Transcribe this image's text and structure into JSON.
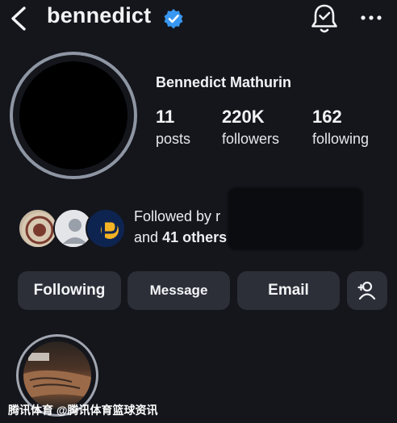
{
  "header": {
    "username": "bennedict",
    "icons": [
      "back-arrow-icon",
      "verified-badge-icon",
      "notification-bell-icon",
      "more-options-icon"
    ]
  },
  "profile": {
    "full_name": "Bennedict Mathurin",
    "stats": [
      {
        "value": "11",
        "label": "posts"
      },
      {
        "value": "220K",
        "label": "followers"
      },
      {
        "value": "162",
        "label": "following"
      }
    ]
  },
  "followed_by": {
    "line1_prefix": "Followed by",
    "line1_name_visible": "r",
    "line2_prefix": "and",
    "others": "41 others"
  },
  "actions": {
    "following": "Following",
    "message": "Message",
    "email": "Email"
  },
  "watermark": {
    "text": "腾讯体育 @腾讯体育篮球资讯"
  },
  "colors": {
    "background": "#14161c",
    "button_bg": "#2c2f38",
    "verified_blue": "#3897f0"
  }
}
